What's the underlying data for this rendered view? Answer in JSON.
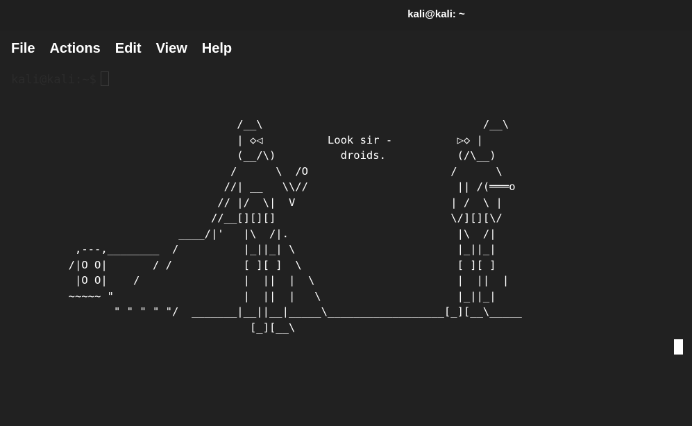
{
  "window": {
    "title": "kali@kali: ~"
  },
  "menu": {
    "items": [
      "File",
      "Actions",
      "Edit",
      "View",
      "Help"
    ]
  },
  "terminal": {
    "prompt": "kali@kali:~$",
    "ascii_art": "                            /__\\                                  /__\\\n                            | ◇◁          Look sir -          ▷◇ |\n                            (__/\\)          droids.           (/\\__)\n                           /      \\  /O                      /      \\\n                          //| __   \\\\//                       || /(═══o\n                         // |/  \\|  V                        | /  \\ |\n                        //__[][][]                           \\/][][\\/\n                   ____/|'   |\\  /|.                          |\\  /|\n   ,---,________  /          |_||_| \\                         |_||_|\n  /|O O|       / /           [ ][ ]  \\                        [ ][ ]\n   |O O|    /                |  ||  |  \\                      |  ||  |\n  ~~~~~ \"                    |  ||  |   \\                     |_||_|\n         \" \" \" \" \"/  _______|__||__|_____\\__________________[_][__\\_____\n                              [_][__\\"
  },
  "colors": {
    "background": "#212121",
    "text": "#ffffff",
    "prompt_faded": "#2b2b2b"
  }
}
